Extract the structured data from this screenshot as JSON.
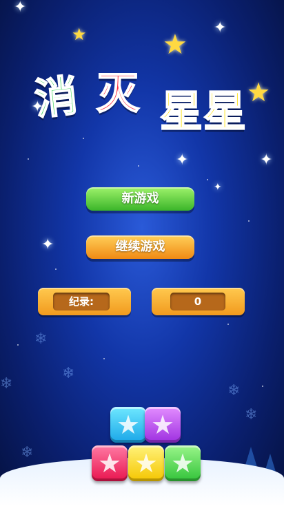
{
  "title": {
    "char1": "消",
    "char2": "灭",
    "char3": "星",
    "char4": "星"
  },
  "menu": {
    "new_game": "新游戏",
    "continue_game": "继续游戏"
  },
  "record": {
    "label": "纪录:",
    "value": "0"
  },
  "tiles": [
    {
      "color": "cyan",
      "symbol": "★"
    },
    {
      "color": "purple",
      "symbol": "★"
    },
    {
      "color": "red",
      "symbol": "★"
    },
    {
      "color": "yellow",
      "symbol": "★"
    },
    {
      "color": "green",
      "symbol": "★"
    }
  ],
  "colors": {
    "green_button": "#3bb52a",
    "orange_button": "#f08a14",
    "background": "#1236a8"
  }
}
